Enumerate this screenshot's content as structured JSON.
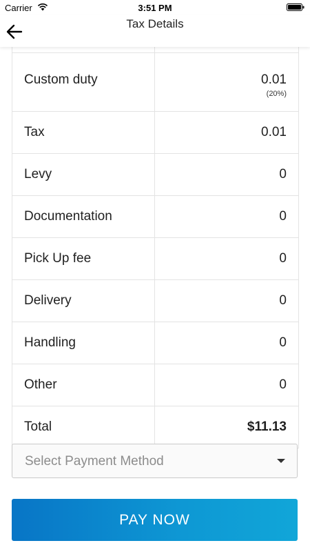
{
  "status_bar": {
    "carrier": "Carrier",
    "time": "3:51 PM"
  },
  "nav": {
    "title": "Tax Details",
    "back_icon": "arrow-left-icon"
  },
  "rows": [
    {
      "label": "Custom duty",
      "value": "0.01",
      "sub": "(20%)"
    },
    {
      "label": "Tax",
      "value": "0.01"
    },
    {
      "label": "Levy",
      "value": "0"
    },
    {
      "label": "Documentation",
      "value": "0"
    },
    {
      "label": "Pick Up fee",
      "value": "0"
    },
    {
      "label": "Delivery",
      "value": "0"
    },
    {
      "label": "Handling",
      "value": "0"
    },
    {
      "label": "Other",
      "value": "0"
    },
    {
      "label": "Total",
      "value": "$11.13"
    }
  ],
  "payment": {
    "placeholder": "Select Payment Method"
  },
  "pay_button": {
    "label": "PAY NOW"
  },
  "colors": {
    "accent": "#0e98d4",
    "accent_dark": "#0875c6"
  }
}
